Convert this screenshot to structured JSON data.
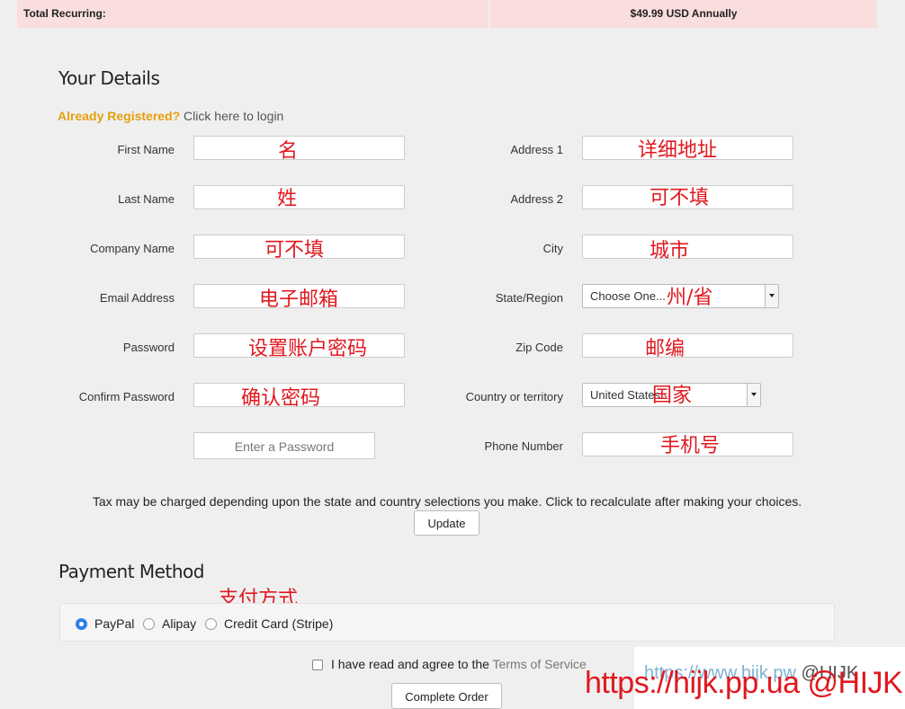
{
  "recurring": {
    "label": "Total Recurring:",
    "value": "$49.99 USD Annually"
  },
  "details": {
    "title": "Your Details",
    "already_registered": "Already Registered?",
    "login_link": " Click here to login",
    "fields_left": [
      {
        "label": "First Name",
        "annotation": "名"
      },
      {
        "label": "Last Name",
        "annotation": "姓"
      },
      {
        "label": "Company Name",
        "annotation": "可不填"
      },
      {
        "label": "Email Address",
        "annotation": "电子邮箱"
      },
      {
        "label": "Password",
        "annotation": "设置账户密码"
      },
      {
        "label": "Confirm Password",
        "annotation": "确认密码"
      }
    ],
    "password_strength": "Enter a Password",
    "fields_right": [
      {
        "label": "Address 1",
        "annotation": "详细地址"
      },
      {
        "label": "Address 2",
        "annotation": "可不填"
      },
      {
        "label": "City",
        "annotation": "城市"
      },
      {
        "label": "State/Region",
        "annotation": "州/省",
        "select_value": "Choose One..."
      },
      {
        "label": "Zip Code",
        "annotation": "邮编"
      },
      {
        "label": "Country or territory",
        "annotation": "国家",
        "select_value": "United States"
      },
      {
        "label": "Phone Number",
        "annotation": "手机号"
      }
    ]
  },
  "tax_note": "Tax may be charged depending upon the state and country selections you make. Click to recalculate after making your choices.",
  "update_button": "Update",
  "payment": {
    "title": "Payment Method",
    "annotation": "支付方式",
    "options": [
      {
        "label": "PayPal",
        "checked": true
      },
      {
        "label": "Alipay",
        "checked": false
      },
      {
        "label": "Credit Card (Stripe)",
        "checked": false
      }
    ]
  },
  "tos": {
    "prefix": "I have read and agree to the ",
    "link": "Terms of Service"
  },
  "complete_button": "Complete Order",
  "watermark": {
    "faint_url": "https://www.hijk.pw",
    "faint_tail": " @HIJK",
    "red": "https://hijk.pp.ua @HIJK"
  },
  "colors": {
    "accent_orange": "#e5a00d",
    "annotation_red": "#e0181f",
    "radio_blue": "#2f7fe8",
    "recurring_bg": "#fadede"
  }
}
